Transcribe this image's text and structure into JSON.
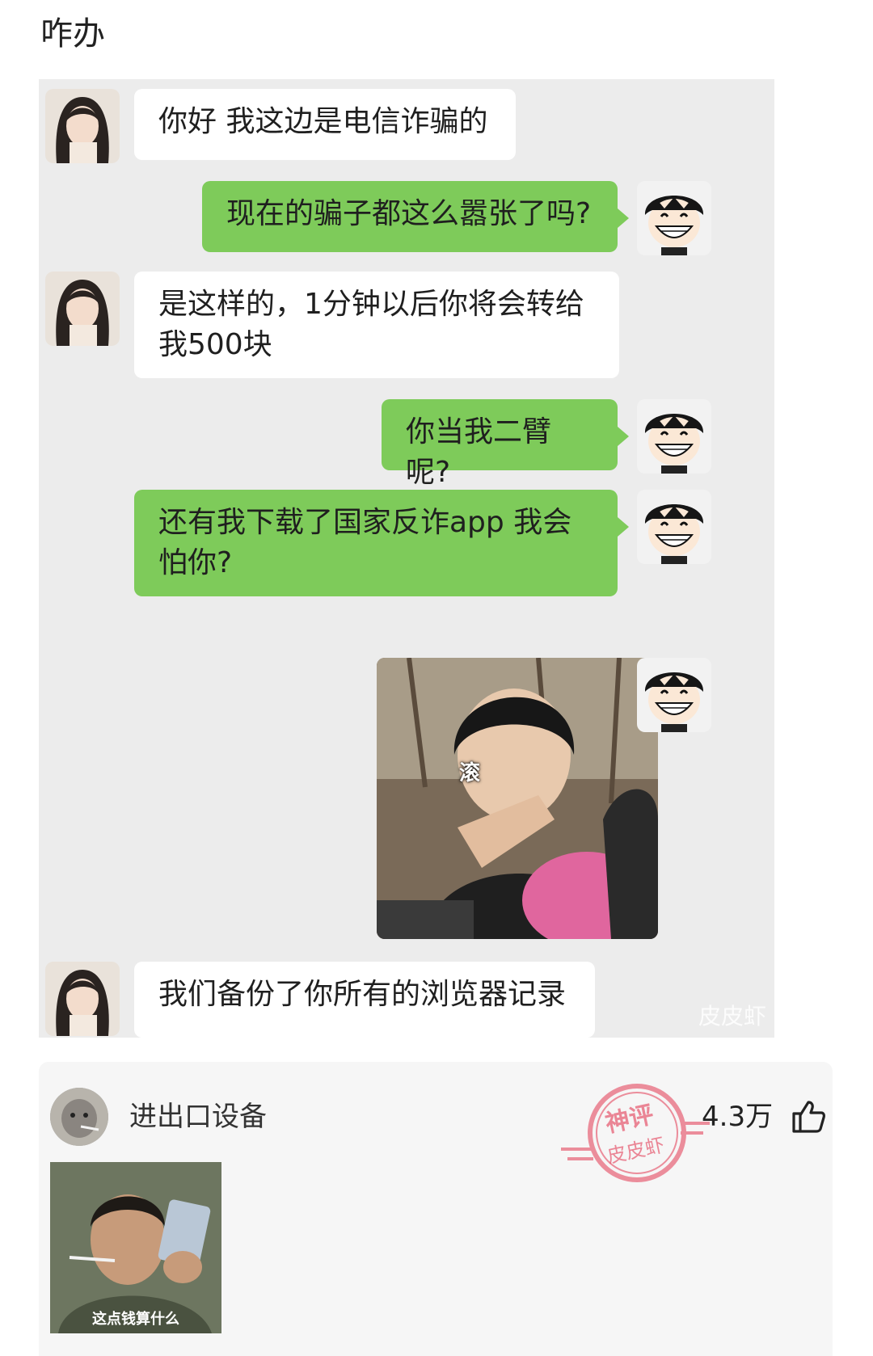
{
  "post": {
    "title": "咋办"
  },
  "chat": {
    "messages": [
      {
        "side": "left",
        "text": "你好 我这边是电信诈骗的"
      },
      {
        "side": "right",
        "text": "现在的骗子都这么嚣张了吗?"
      },
      {
        "side": "left",
        "text": "是这样的，1分钟以后你将会转给我500块"
      },
      {
        "side": "right",
        "text": "你当我二臂呢?"
      },
      {
        "side": "right",
        "text": "还有我下载了国家反诈app 我会怕你?"
      },
      {
        "side": "right",
        "type": "image",
        "sticker_text": "滚"
      },
      {
        "side": "left",
        "text": "我们备份了你所有的浏览器记录"
      }
    ],
    "watermark": "皮皮虾"
  },
  "comment": {
    "username": "进出口设备",
    "likes": "4.3万",
    "stamp_top": "神评",
    "stamp_bottom": "皮皮虾",
    "image_caption": "这点钱算什么",
    "icons": {
      "like": "thumbs-up-icon"
    }
  },
  "colors": {
    "chat_bg": "#ececec",
    "bubble_sent": "#7ecb5a",
    "bubble_received": "#ffffff",
    "stamp": "#e86a7d"
  }
}
